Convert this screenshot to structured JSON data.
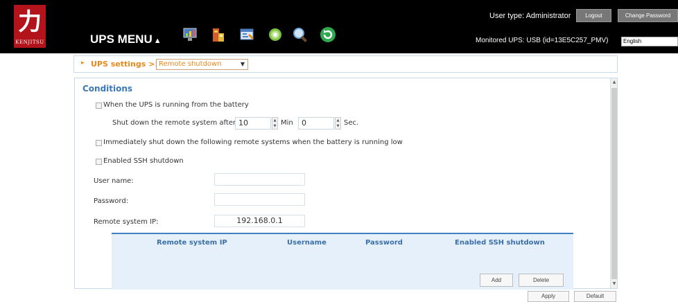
{
  "header": {
    "logo_glyph": "力",
    "brand": "KENJITSU",
    "menu_title": "UPS MENU",
    "menu_arrow": "▲",
    "user_type": "User type: Administrator",
    "logout_label": "Logout",
    "change_password_label": "Change Password",
    "monitored_ups": "Monitored UPS: USB (id=13E5C257_PMV)",
    "language": "English",
    "toolbar_icons": [
      "monitor-chart-icon",
      "battery-icon",
      "settings-panel-icon",
      "gear-icon",
      "search-icon",
      "refresh-icon"
    ]
  },
  "breadcrumb": {
    "arrow": "▸",
    "section": "UPS settings >>",
    "selected_page": "Remote shutdown"
  },
  "conditions": {
    "title": "Conditions",
    "on_battery_label": "When the UPS is running from the battery",
    "shutdown_after_label": "Shut down the remote system after",
    "minutes_value": "10",
    "min_unit": "Min",
    "seconds_value": "0",
    "sec_unit": "Sec.",
    "immediate_label": "Immediately shut down the following remote systems when the battery is running low",
    "ssh_label": "Enabled SSH shutdown",
    "username_label": "User name:",
    "username_value": "",
    "password_label": "Password:",
    "password_value": "",
    "remote_ip_label": "Remote system IP:",
    "remote_ip_value": "192.168.0.1"
  },
  "table": {
    "columns": [
      "Remote system IP",
      "Username",
      "Password",
      "Enabled SSH shutdown"
    ],
    "rows": [],
    "add_label": "Add",
    "delete_label": "Delete"
  },
  "footer": {
    "apply_label": "Apply",
    "default_label": "Default"
  },
  "colors": {
    "accent_orange": "#e8891c",
    "title_blue": "#3a78b8",
    "header_bg": "#000000",
    "logo_red": "#b3131b"
  }
}
